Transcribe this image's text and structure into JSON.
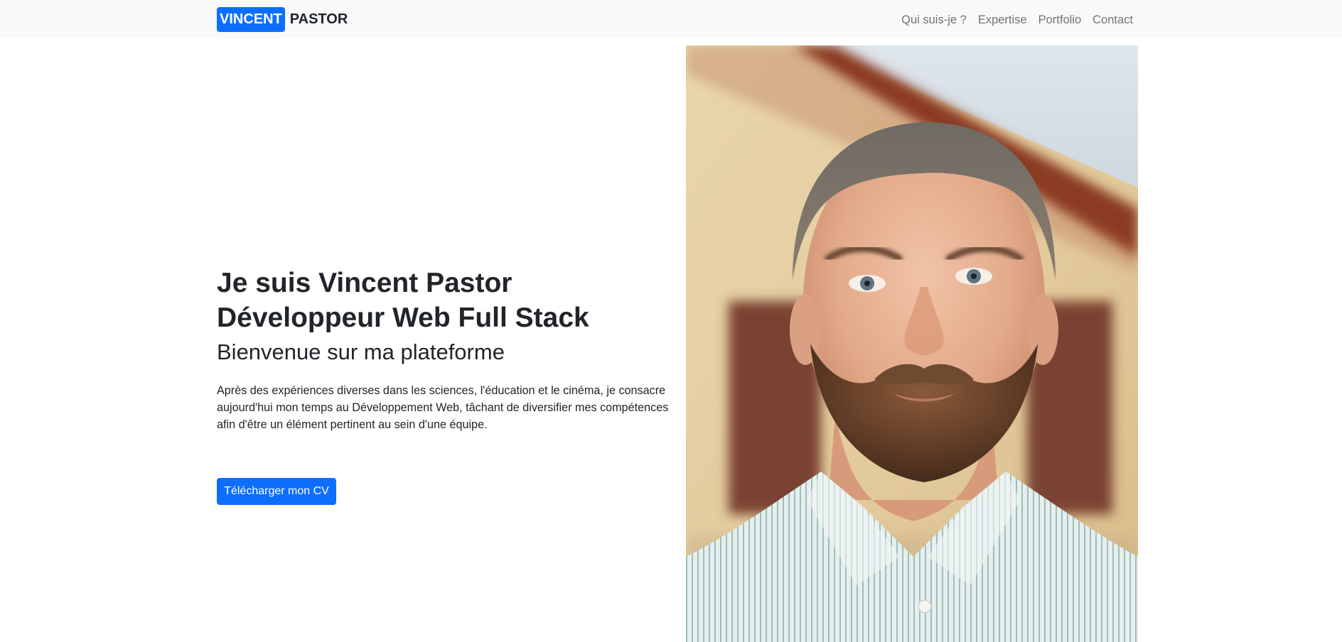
{
  "navbar": {
    "brand_first": "VINCENT",
    "brand_last": "PASTOR",
    "links": [
      "Qui suis-je ?",
      "Expertise",
      "Portfolio",
      "Contact"
    ]
  },
  "hero": {
    "title_line1": "Je suis Vincent Pastor",
    "title_line2": "Développeur Web Full Stack",
    "subtitle": "Bienvenue sur ma plateforme",
    "description": "Après des expériences diverses dans les sciences, l'éducation et le cinéma, je consacre aujourd'hui mon temps au Développement Web, tâchant de diversifier mes compétences afin d'être un élément pertinent au sein d'une équipe.",
    "cta_label": "Télécharger mon CV"
  },
  "portrait": {
    "subject": "portrait-photo"
  },
  "colors": {
    "accent": "#0d6efd",
    "navbar_bg": "#f8f9fa",
    "text": "#212529"
  }
}
